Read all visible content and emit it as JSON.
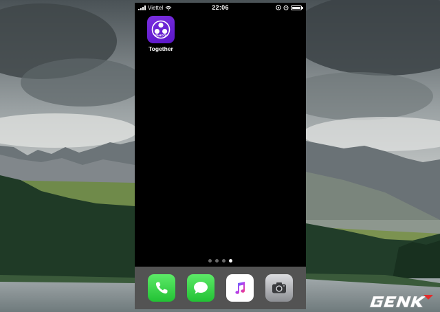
{
  "status_bar": {
    "carrier": "Viettel",
    "time": "22:06",
    "icons": [
      "signal-icon",
      "wifi-icon",
      "orientation-lock-icon",
      "alarm-icon",
      "battery-icon"
    ]
  },
  "home_apps": [
    {
      "label": "Together",
      "icon": "yahoo-together-icon",
      "icon_text": "YAHOO!",
      "color": "#6a1fd6"
    }
  ],
  "page_indicator": {
    "count": 4,
    "active_index": 3
  },
  "dock_apps": [
    {
      "name": "Phone",
      "icon": "phone-icon"
    },
    {
      "name": "Messages",
      "icon": "messages-icon"
    },
    {
      "name": "Music",
      "icon": "music-icon"
    },
    {
      "name": "Camera",
      "icon": "camera-icon"
    }
  ],
  "watermark": {
    "icon": "genk-logo"
  }
}
